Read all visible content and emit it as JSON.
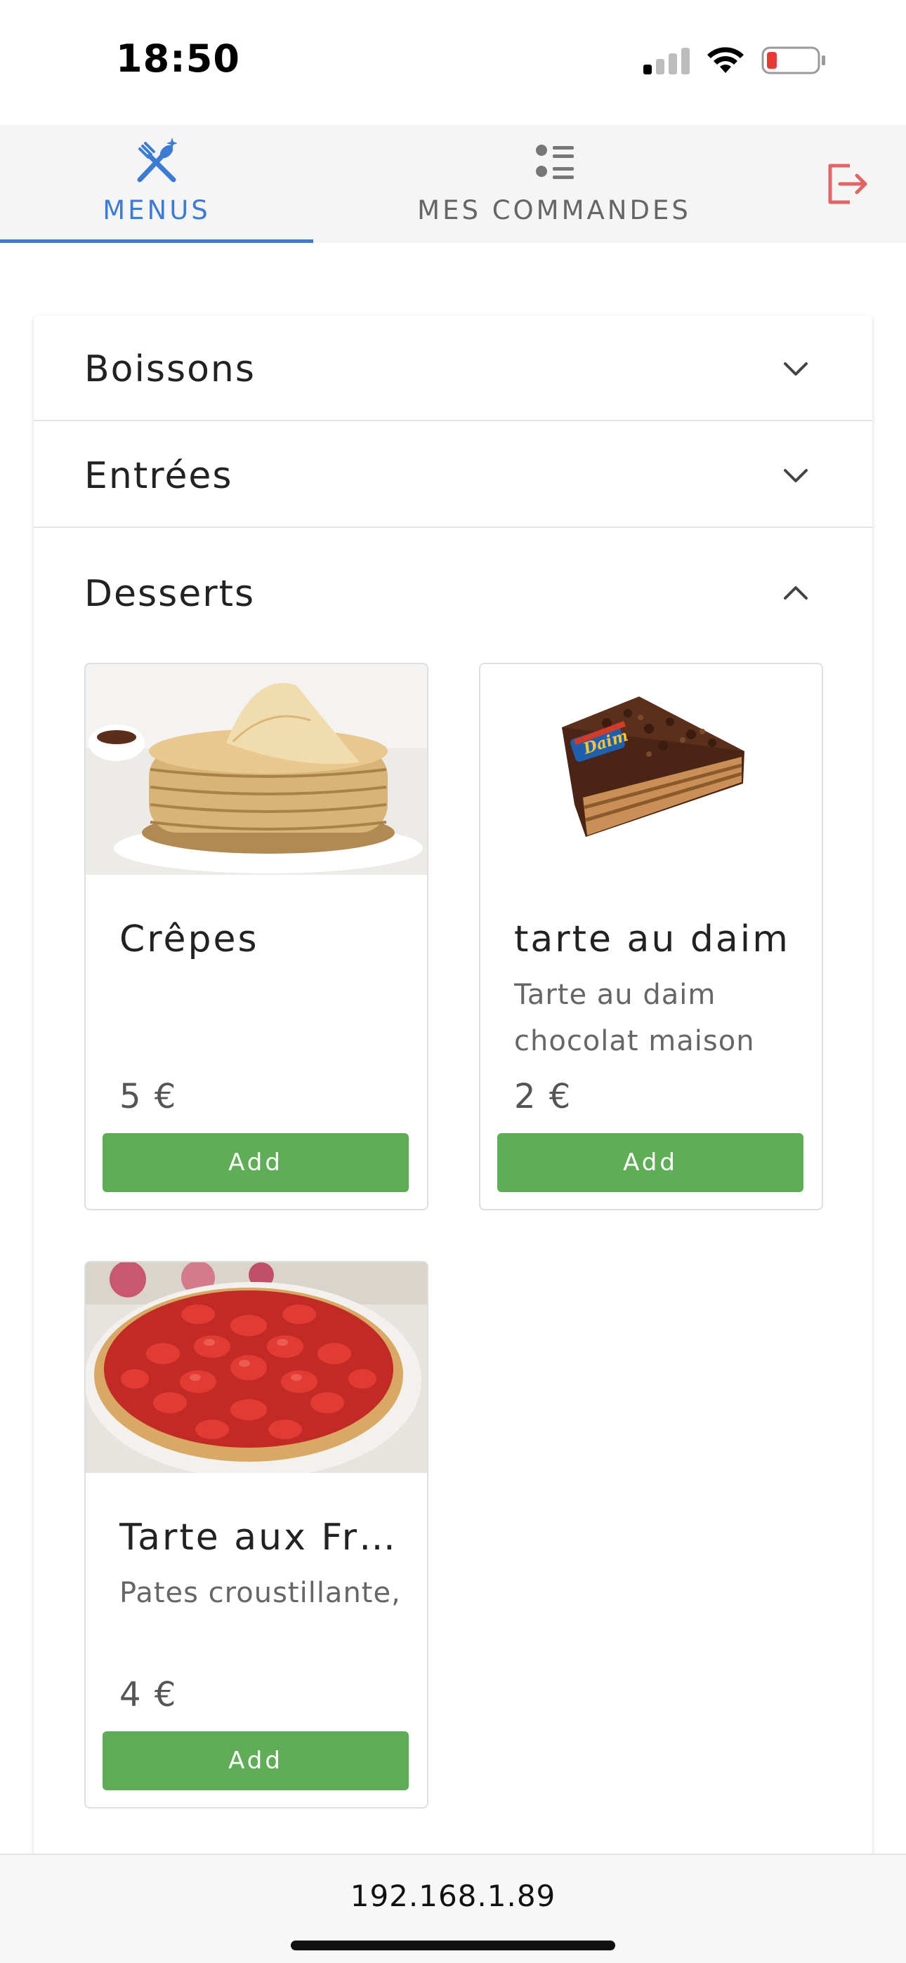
{
  "status_bar": {
    "time": "18:50"
  },
  "nav": {
    "tabs": [
      {
        "label": "MENUS",
        "icon": "utensils-sparkle-icon",
        "active": true
      },
      {
        "label": "MES COMMANDES",
        "icon": "list-icon",
        "active": false
      }
    ],
    "logout_icon": "logout-icon",
    "accent_color": "#3d7bd4",
    "logout_color": "#e06666"
  },
  "categories": [
    {
      "name": "Boissons",
      "expanded": false
    },
    {
      "name": "Entrées",
      "expanded": false
    },
    {
      "name": "Desserts",
      "expanded": true
    }
  ],
  "desserts": [
    {
      "title": "Crêpes",
      "description": "",
      "price": "5 €",
      "add_label": "Add",
      "image": "crepes-stack"
    },
    {
      "title": "tarte au daim",
      "description": "Tarte au daim chocolat maison",
      "price": "2 €",
      "add_label": "Add",
      "image": "daim-cake-slice"
    },
    {
      "title": "Tarte aux Fraises",
      "description": "Pates croustillante,",
      "price": "4 €",
      "add_label": "Add",
      "image": "strawberry-tart"
    }
  ],
  "add_button_color": "#5fad56",
  "url_bar": {
    "url": "192.168.1.89"
  }
}
